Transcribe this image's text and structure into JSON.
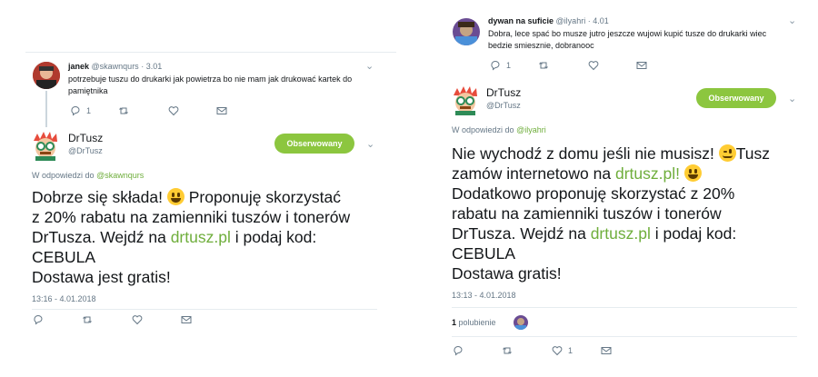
{
  "left": {
    "reply_tweet": {
      "name": "janek",
      "handle": "@skawnqurs",
      "sep": "·",
      "time": "3.01",
      "text_line1": "potrzebuje tuszu do drukarki jak powietrza bo nie mam jak drukować kartek do",
      "text_line2": "pamiętnika",
      "reply_count": "1"
    },
    "main_tweet": {
      "name": "DrTusz",
      "handle": "@DrTusz",
      "follow_label": "Obserwowany",
      "in_reply_prefix": "W odpowiedzi do",
      "in_reply_handle": "@skawnqurs",
      "line1_a": "Dobrze się składa!",
      "line1_b": "Proponuję skorzystać",
      "line2": "z 20% rabatu na zamienniki tuszów i tonerów",
      "line3_a": "DrTusza. Wejdź na",
      "line3_link": "drtusz.pl",
      "line3_b": "i podaj kod:",
      "line4": "CEBULA",
      "line5": "Dostawa jest gratis!",
      "timestamp": "13:16 - 4.01.2018"
    }
  },
  "right": {
    "reply_tweet": {
      "name": "dywan na suficie",
      "handle": "@ilyahri",
      "sep": "·",
      "time": "4.01",
      "text_line1": "Dobra, lece spać bo musze jutro jeszcze wujowi kupić tusze do drukarki wiec",
      "text_line2": "bedzie smiesznie, dobranooc",
      "reply_count": "1"
    },
    "main_tweet": {
      "name": "DrTusz",
      "handle": "@DrTusz",
      "follow_label": "Obserwowany",
      "in_reply_prefix": "W odpowiedzi do",
      "in_reply_handle": "@ilyahri",
      "line1_a": "Nie wychodź z domu jeśli nie musisz!",
      "line1_b": "Tusz",
      "line2_a": "zamów internetowo na",
      "line2_link": "drtusz.pl!",
      "line3": "Dodatkowo proponuję skorzystać z 20%",
      "line4": "rabatu na zamienniki tuszów i tonerów",
      "line5_a": "DrTusza. Wejdź na",
      "line5_link": "drtusz.pl",
      "line5_b": "i podaj kod:",
      "line6": "CEBULA",
      "line7": "Dostawa gratis!",
      "timestamp": "13:13 - 4.01.2018",
      "likes_count": "1",
      "likes_label": "polubienie",
      "like_action_count": "1"
    }
  },
  "colors": {
    "accent": "#8cc63f",
    "link": "#6fae3c",
    "muted": "#657786"
  }
}
